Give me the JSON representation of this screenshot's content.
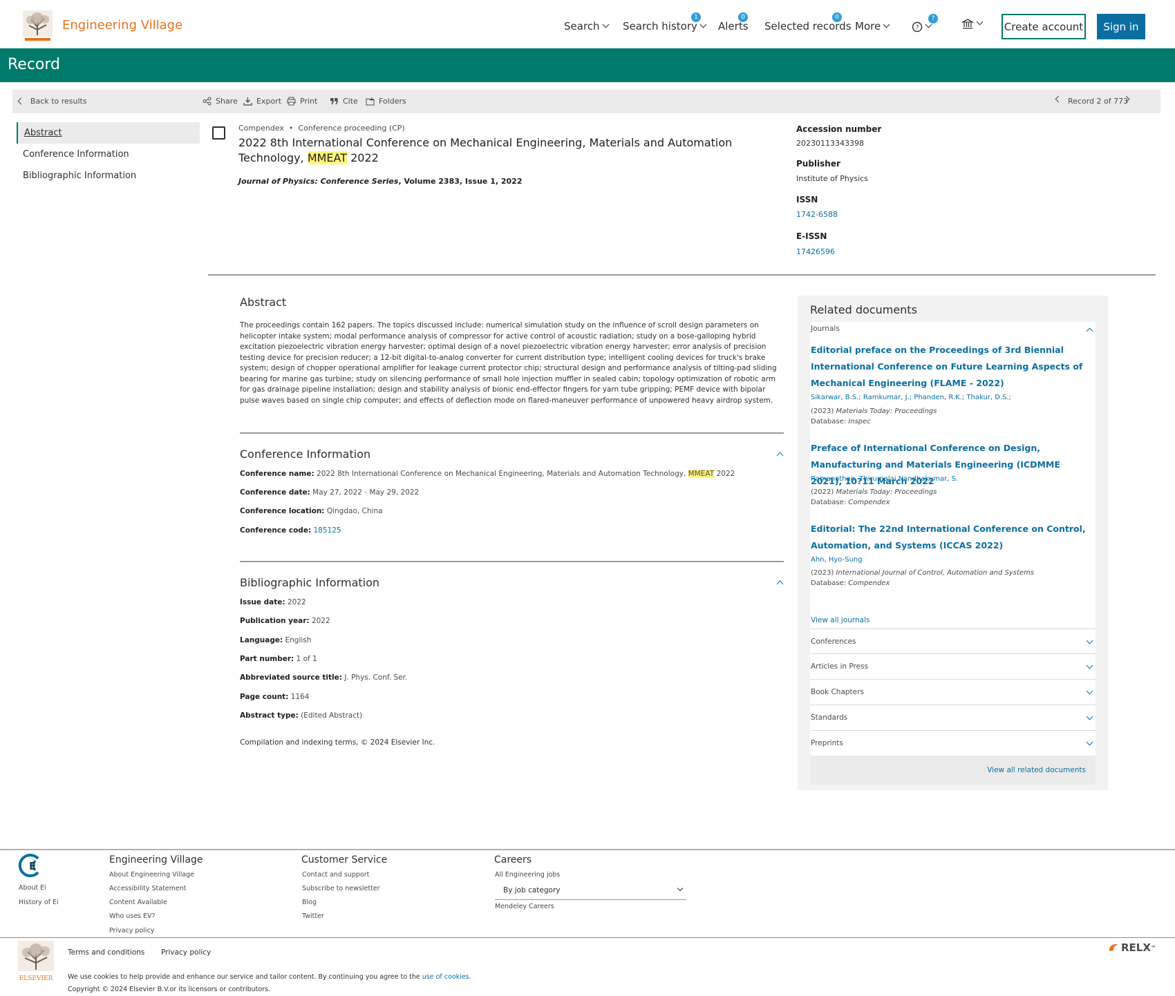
{
  "header": {
    "brand": "Engineering Village",
    "nav": {
      "search": "Search",
      "search_history": "Search history",
      "search_history_badge": "1",
      "alerts": "Alerts",
      "alerts_badge": "0",
      "selected_records": "Selected records",
      "selected_records_badge": "0",
      "more": "More",
      "help_badge": "?"
    },
    "create_account": "Create account",
    "sign_in": "Sign in"
  },
  "banner": {
    "title": "Record"
  },
  "toolbar": {
    "back": "Back to results",
    "share": "Share",
    "export": "Export",
    "print": "Print",
    "cite": "Cite",
    "folders": "Folders",
    "record_position": "Record 2 of 773"
  },
  "left_nav": {
    "items": [
      "Abstract",
      "Conference Information",
      "Bibliographic Information"
    ]
  },
  "record": {
    "database": "Compendex",
    "doc_type": "Conference proceeding (CP)",
    "title_main": "2022 8th International Conference on Mechanical Engineering, Materials and Automation Technology,",
    "title_highlight": "MMEAT",
    "title_end": " 2022",
    "source_journal": "Journal of Physics: Conference Series",
    "source_rest": ", Volume 2383, Issue 1, 2022"
  },
  "record_fields": {
    "accession_label": "Accession number",
    "accession_value": "20230113343398",
    "publisher_label": "Publisher",
    "publisher_value": "Institute of Physics",
    "issn_label": "ISSN",
    "issn_value": "1742-6588",
    "eissn_label": "E-ISSN",
    "eissn_value": "17426596"
  },
  "abstract": {
    "heading": "Abstract",
    "text": "The proceedings contain 162 papers. The topics discussed include: numerical simulation study on the influence of scroll design parameters on helicopter intake system; modal performance analysis of compressor for active control of acoustic radiation; study on a bose-galloping hybrid excitation piezoelectric vibration energy harvester; optimal design of a novel piezoelectric vibration energy harvester; error analysis of precision testing device for precision reducer; a 12-bit digital-to-analog converter for current distribution type; intelligent cooling devices for truck's brake system; design of chopper operational amplifier for leakage current protector chip; structural design and performance analysis of tilting-pad sliding bearing for marine gas turbine; study on silencing performance of small hole injection muffler in sealed cabin; topology optimization of robotic arm for gas drainage pipeline installation; design and stability analysis of bionic end-effector fingers for yarn tube gripping; PEMF device with bipolar pulse waves based on single chip computer; and effects of deflection mode on flared-maneuver performance of unpowered heavy airdrop system."
  },
  "conference": {
    "heading": "Conference Information",
    "name_label": "Conference name:",
    "name_value": "2022 8th International Conference on Mechanical Engineering, Materials and Automation Technology,",
    "name_highlight": "MMEAT",
    "name_end": " 2022",
    "date_label": "Conference date:",
    "date_value": "May 27, 2022 - May 29, 2022",
    "location_label": "Conference location:",
    "location_value": "Qingdao, China",
    "code_label": "Conference code:",
    "code_value": "185125"
  },
  "bibliographic": {
    "heading": "Bibliographic Information",
    "rows": [
      {
        "label": "Issue date:",
        "value": "2022"
      },
      {
        "label": "Publication year:",
        "value": "2022"
      },
      {
        "label": "Language:",
        "value": "English"
      },
      {
        "label": "Part number:",
        "value": "1 of 1"
      },
      {
        "label": "Abbreviated source title:",
        "value": "J. Phys. Conf. Ser."
      },
      {
        "label": "Page count:",
        "value": "1164"
      },
      {
        "label": "Abstract type:",
        "value": "(Edited Abstract)"
      }
    ],
    "copyright": "Compilation and indexing terms, © 2024 Elsevier Inc."
  },
  "related": {
    "heading": "Related documents",
    "journals_label": "Journals",
    "docs": [
      {
        "title": "Editorial preface on the Proceedings of 3rd Biennial International Conference on Future Learning Aspects of Mechanical Engineering (FLAME - 2022)",
        "authors": "Sikarwar, B.S.; Ramkumar, J.; Phanden, R.K.; Thakur, D.S.;",
        "year": "(2023)",
        "source": "Materials Today: Proceedings",
        "database_label": "Database:",
        "database": "Inspec"
      },
      {
        "title": "Preface of International Conference on Design, Manufacturing and Materials Engineering (ICDMME 2021), 10?11 March 2022",
        "authors": "Ramanathan, Thirumalai Nandhakumar, S.",
        "year": "(2022)",
        "source": "Materials Today: Proceedings",
        "database_label": "Database:",
        "database": "Compendex"
      },
      {
        "title": "Editorial: The 22nd International Conference on Control, Automation, and Systems (ICCAS 2022)",
        "authors": "Ahn, Hyo-Sung",
        "year": "(2023)",
        "source": "International Journal of Control, Automation and Systems",
        "database_label": "Database:",
        "database": "Compendex"
      }
    ],
    "view_all_journals": "View all journals",
    "categories": [
      "Conferences",
      "Articles in Press",
      "Book Chapters",
      "Standards",
      "Preprints"
    ],
    "view_all_related": "View all related documents"
  },
  "footer": {
    "about_ei": "About Ei",
    "history_ei": "History of Ei",
    "col1_head": "Engineering Village",
    "col1_links": [
      "About Engineering Village",
      "Accessibility Statement",
      "Content Available",
      "Who uses EV?",
      "Privacy policy"
    ],
    "col2_head": "Customer Service",
    "col2_links": [
      "Contact and support",
      "Subscribe to newsletter",
      "Blog",
      "Twitter"
    ],
    "col3_head": "Careers",
    "col3_link": "All Engineering jobs",
    "jobs_select": "By job category",
    "mendeley": "Mendeley Careers",
    "terms": "Terms and conditions",
    "privacy": "Privacy policy",
    "cookies_text": "We use cookies to help provide and enhance our service and tailor content. By continuing you agree to the",
    "cookies_link": "use of cookies",
    "copyright": "Copyright © 2024 Elsevier B.V.or its licensors or contributors.",
    "relx": "RELX",
    "elsevier": "ELSEVIER"
  },
  "colors": {
    "brand_orange": "#e9711c",
    "teal": "#007a6a",
    "link_blue": "#0b6ea1",
    "badge_blue": "#2d9fd8",
    "highlight": "#fff57a"
  }
}
